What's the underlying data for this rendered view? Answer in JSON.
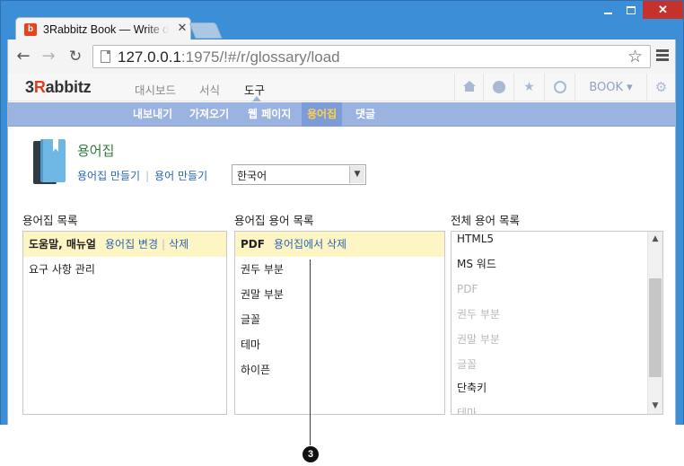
{
  "browser": {
    "tab_title": "3Rabbitz Book — Write d",
    "tab_favicon": "b",
    "tab_close": "×",
    "window_controls": {
      "minimize": "–",
      "maximize": "□",
      "close": "✕"
    },
    "url_host": "127.0.0.1",
    "url_rest": ":1975/!#/r/glossary/load",
    "icons": [
      "back-arrow-icon",
      "forward-arrow-icon",
      "reload-icon",
      "page-icon",
      "bookmark-star-icon",
      "menu-icon"
    ]
  },
  "app": {
    "logo_prefix": "3",
    "logo_r": "R",
    "logo_rest": "abbitz",
    "main_nav": [
      "대시보드",
      "서식",
      "도구"
    ],
    "book_label": "BOOK ▾",
    "sub_nav": [
      "내보내기",
      "가져오기",
      "웹 페이지",
      "용어집",
      "댓글"
    ],
    "active_sub_nav": "용어집",
    "accent_color": "#9bb3e0",
    "active_color": "#ffd24a"
  },
  "page": {
    "title": "용어집",
    "create_glossary_link": "용어집 만들기",
    "create_term_link": "용어 만들기",
    "language_value": "한국어"
  },
  "glossary_list": {
    "title": "용어집 목록",
    "items": [
      {
        "name": "도움말, 매뉴얼",
        "edit": "용어집 변경",
        "delete": "삭제"
      },
      {
        "name": "요구 사항 관리"
      }
    ]
  },
  "glossary_terms": {
    "title": "용어집 용어 목록",
    "items": [
      {
        "name": "PDF",
        "action": "용어집에서 삭제"
      },
      {
        "name": "권두 부분"
      },
      {
        "name": "권말 부분"
      },
      {
        "name": "글꼴"
      },
      {
        "name": "테마"
      },
      {
        "name": "하이픈"
      }
    ]
  },
  "all_terms": {
    "title": "전체 용어 목록",
    "items": [
      "HTML5",
      "MS 워드",
      "PDF",
      "권두 부분",
      "권말 부분",
      "글꼴",
      "단축키",
      "테마"
    ]
  },
  "callout": {
    "number": "3"
  }
}
